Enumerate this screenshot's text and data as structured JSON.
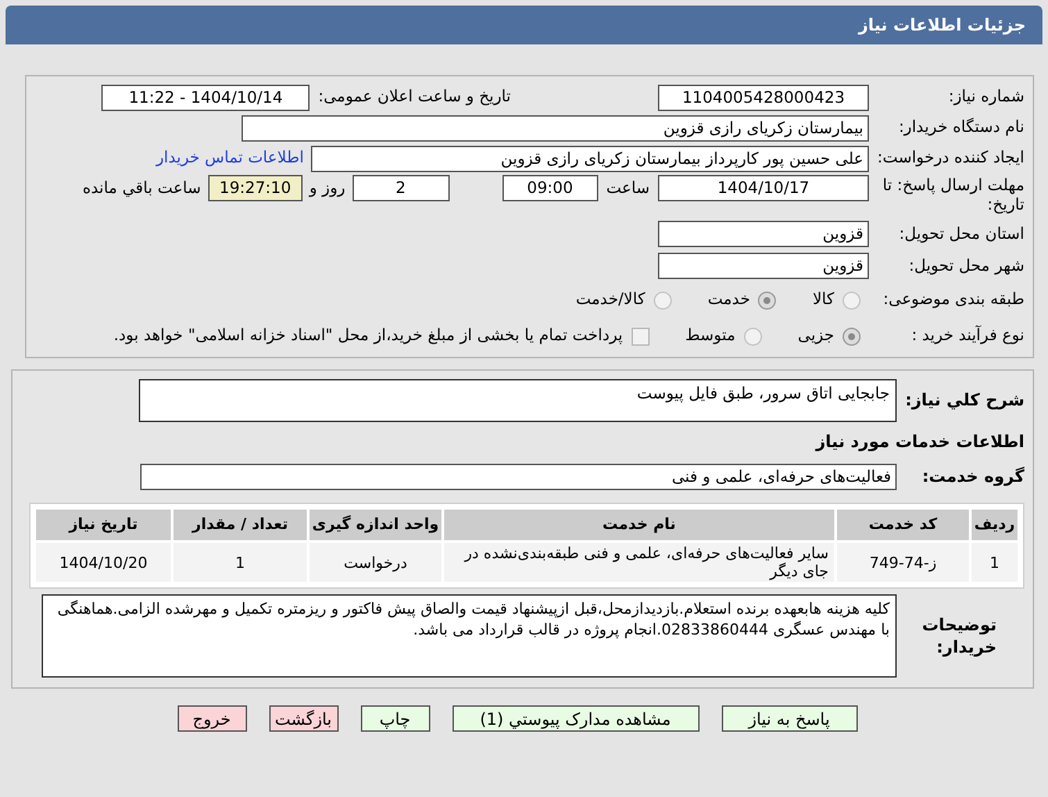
{
  "header": {
    "title": "جزئیات اطلاعات نیاز"
  },
  "need_number": {
    "label": "شماره نیاز:",
    "value": "1104005428000423"
  },
  "announce": {
    "label": "تاریخ و ساعت اعلان عمومی:",
    "value": "1404/10/14 - 11:22"
  },
  "buyer": {
    "label": "نام دستگاه خریدار:",
    "value": "بیمارستان زکریای رازی قزوین"
  },
  "requester": {
    "label": "ایجاد کننده درخواست:",
    "value": "علی حسین پور کارپرداز بیمارستان زکریای رازی قزوین",
    "link": "اطلاعات تماس خریدار"
  },
  "deadline": {
    "label": "مهلت ارسال پاسخ: تا تاریخ:",
    "date": "1404/10/17",
    "time_label": "ساعت",
    "time": "09:00",
    "days": "2",
    "days_label": "روز و",
    "remaining": "19:27:10",
    "remaining_label": "ساعت باقي مانده"
  },
  "province": {
    "label": "استان محل تحویل:",
    "value": "قزوین"
  },
  "city": {
    "label": "شهر محل تحویل:",
    "value": "قزوین"
  },
  "category": {
    "label": "طبقه بندی موضوعی:",
    "options": [
      {
        "label": "کالا",
        "selected": false
      },
      {
        "label": "خدمت",
        "selected": true
      },
      {
        "label": "کالا/خدمت",
        "selected": false
      }
    ]
  },
  "process": {
    "label": "نوع فرآیند خرید :",
    "options": [
      {
        "label": "جزیی",
        "selected": true
      },
      {
        "label": "متوسط",
        "selected": false
      }
    ],
    "payment": {
      "checked": false,
      "text": "پرداخت تمام یا بخشی از مبلغ خرید،از محل \"اسناد خزانه اسلامی\" خواهد بود."
    }
  },
  "description": {
    "label": "شرح کلي نیاز:",
    "value": "جابجایی اتاق سرور، طبق فایل پیوست"
  },
  "services_heading": "اطلاعات خدمات مورد نیاز",
  "service_group": {
    "label": "گروه خدمت:",
    "value": "فعالیت‌های حرفه‌ای، علمی و فنی"
  },
  "table": {
    "columns": [
      "ردیف",
      "کد خدمت",
      "نام خدمت",
      "واحد اندازه گیری",
      "تعداد / مقدار",
      "تاریخ نیاز"
    ],
    "rows": [
      [
        "1",
        "ز-74-749",
        "سایر فعالیت‌های حرفه‌ای، علمی و فنی طبقه‌بندی‌نشده در جای دیگر",
        "درخواست",
        "1",
        "1404/10/20"
      ]
    ]
  },
  "buyer_notes": {
    "label": "توضیحات خریدار:",
    "value": "کلیه هزینه هابعهده برنده استعلام.بازدیدازمحل،قبل ازپیشنهاد قیمت والصاق پیش فاکتور و ریزمتره تکمیل و مهرشده الزامی.هماهنگی با مهندس عسگری 02833860444.انجام پروژه در قالب قرارداد می باشد."
  },
  "buttons": [
    {
      "label": "پاسخ به نیاز",
      "kind": "action"
    },
    {
      "label": "مشاهده مدارک پیوستي (1)",
      "kind": "action"
    },
    {
      "label": "چاپ",
      "kind": "action"
    },
    {
      "label": "بازگشت",
      "kind": "exit"
    },
    {
      "label": "خروج",
      "kind": "exit"
    }
  ]
}
